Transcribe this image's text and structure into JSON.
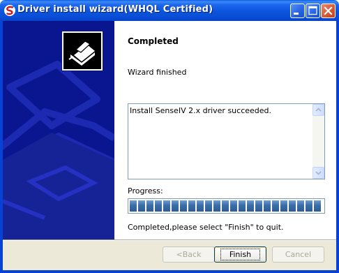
{
  "window": {
    "title": "Driver install wizard(WHQL Certified)",
    "accent_color": "#0A54DC",
    "controls": [
      "minimize-icon",
      "maximize-icon",
      "close-icon"
    ]
  },
  "sidebar": {
    "icon": "printer-icon",
    "background_color": "#0A1690"
  },
  "main": {
    "heading": "Completed",
    "subheading": "Wizard finished",
    "log_text": "Install SenseIV 2.x driver succeeded.",
    "progress_label": "Progress:",
    "progress_value": 1.0,
    "progress_color": "#3A6EA5",
    "status_text": "Completed,please select \"Finish\" to quit."
  },
  "buttons": {
    "back": "<Back",
    "finish": "Finish",
    "cancel": "Cancel"
  }
}
